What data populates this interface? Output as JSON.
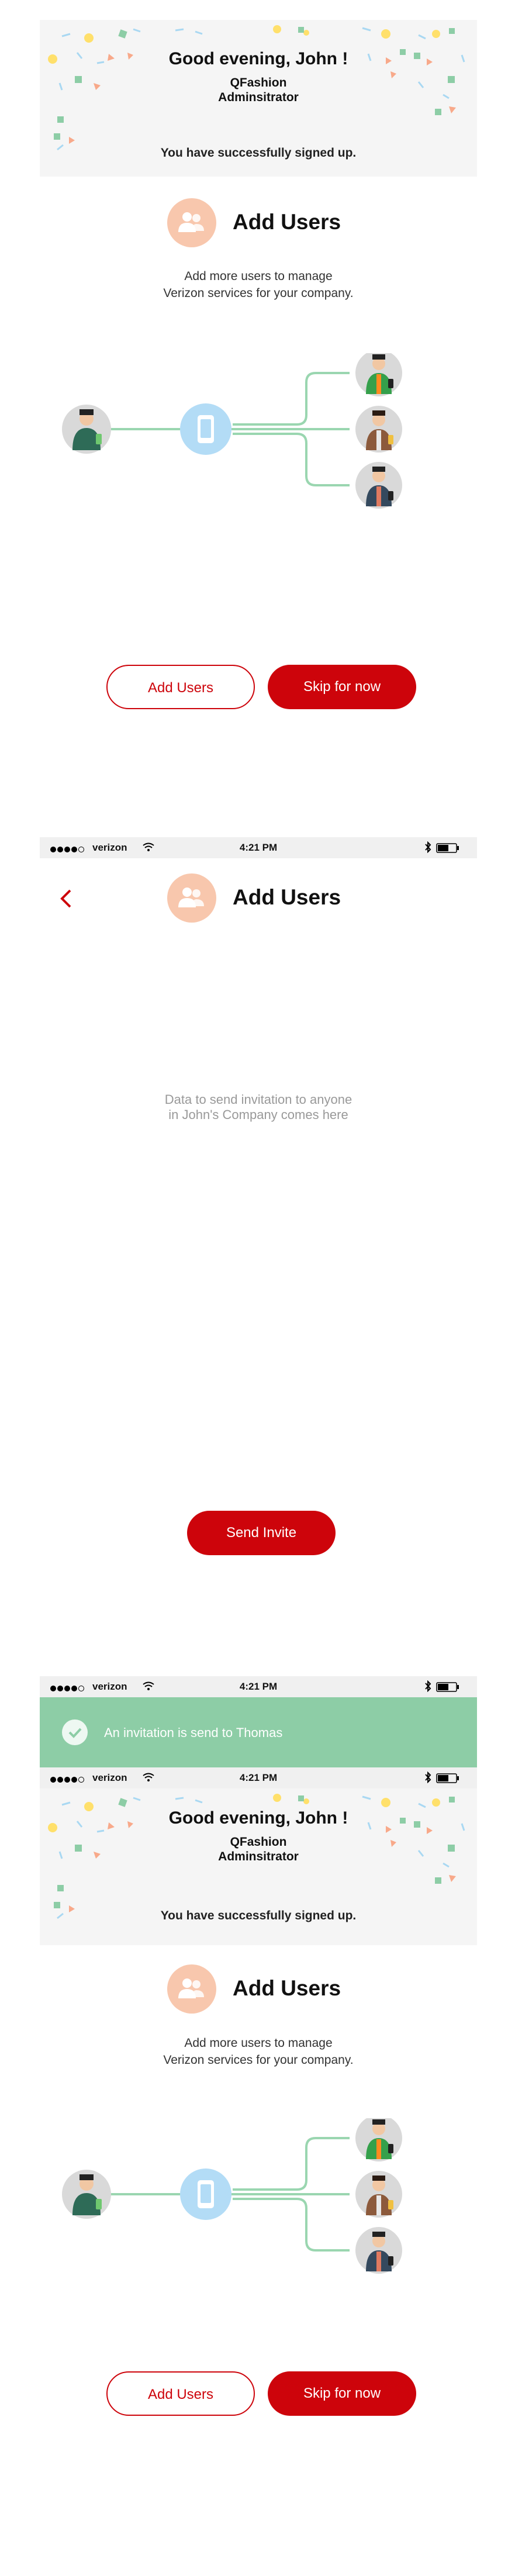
{
  "onboarding": {
    "greeting": "Good evening, John !",
    "company": "QFashion",
    "role": "Adminsitrator",
    "success_message": "You have successfully signed up.",
    "section_title": "Add Users",
    "description_line1": "Add more users to manage",
    "description_line2": "Verizon services for your company.",
    "add_users_button": "Add Users",
    "skip_button": "Skip for now"
  },
  "status_bar": {
    "carrier": "verizon",
    "time": "4:21 PM"
  },
  "add_users_screen": {
    "title": "Add Users",
    "placeholder_line1": "Data to send invitation to anyone",
    "placeholder_line2": "in John's Company comes here",
    "send_button": "Send Invite"
  },
  "toast": {
    "message": "An invitation is send to Thomas"
  },
  "icons": {
    "users": "users-icon",
    "back": "chevron-left-icon",
    "check": "check-icon",
    "phone": "phone-icon",
    "wifi": "wifi-icon",
    "bluetooth": "bluetooth-icon",
    "battery": "battery-icon"
  },
  "colors": {
    "brand_red": "#cd040b",
    "toast_green": "#8dcda6",
    "avatar_peach": "#f8c7ad",
    "line_green": "#9ad6b0",
    "phone_blue": "#b3dcf6"
  }
}
